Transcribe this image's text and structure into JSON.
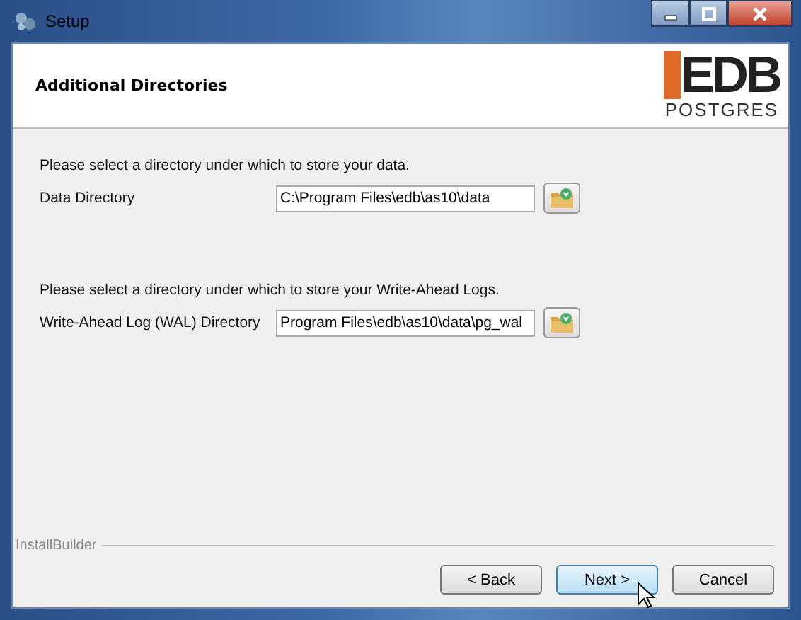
{
  "window": {
    "title": "Setup"
  },
  "header": {
    "title": "Additional Directories",
    "logo": {
      "main": "EDB",
      "sub": "POSTGRES"
    }
  },
  "sections": [
    {
      "prompt": "Please select a directory under which to store your data.",
      "label": "Data Directory",
      "value": "C:\\Program Files\\edb\\as10\\data"
    },
    {
      "prompt": "Please select a directory under which to store your Write-Ahead Logs.",
      "label": "Write-Ahead Log (WAL) Directory",
      "value": "Program Files\\edb\\as10\\data\\pg_wal"
    }
  ],
  "footer": {
    "brand": "InstallBuilder"
  },
  "buttons": [
    {
      "label": "< Back",
      "hovered": false
    },
    {
      "label": "Next >",
      "hovered": true
    },
    {
      "label": "Cancel",
      "hovered": false
    }
  ]
}
